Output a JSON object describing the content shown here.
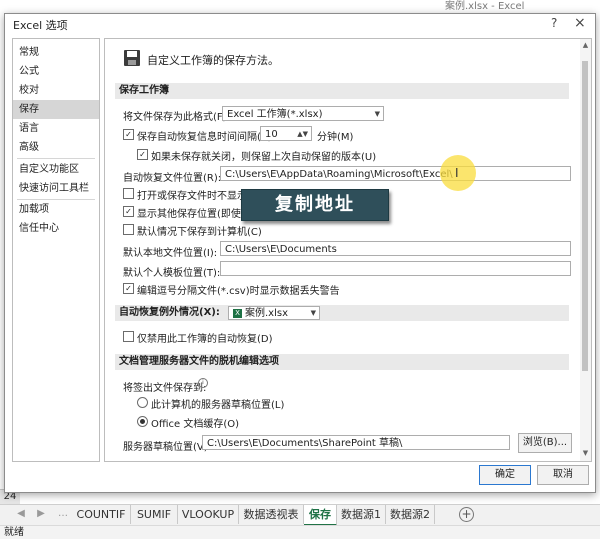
{
  "excel": {
    "window_title": "案例.xlsx - Excel",
    "row_number": "24",
    "status": "就绪",
    "sheets": [
      "COUNTIF",
      "SUMIF",
      "VLOOKUP",
      "数据透视表",
      "保存",
      "数据源1",
      "数据源2"
    ],
    "active_sheet": "保存"
  },
  "dialog": {
    "title": "Excel 选项",
    "help": "?",
    "close": "×",
    "nav": [
      "常规",
      "公式",
      "校对",
      "保存",
      "语言",
      "高级",
      "自定义功能区",
      "快速访问工具栏",
      "加载项",
      "信任中心"
    ],
    "selected_nav": "保存",
    "header_text": "自定义工作簿的保存方法。",
    "sections": {
      "save_workbook": "保存工作簿",
      "autorecover_exceptions": "自动恢复例外情况(X):",
      "offline_editing": "文档管理服务器文件的脱机编辑选项"
    },
    "format_label": "将文件保存为此格式(F):",
    "format_value": "Excel 工作簿(*.xlsx)",
    "autorecover_label": "保存自动恢复信息时间间隔(A)",
    "autorecover_minutes": "10",
    "minutes_label": "分钟(M)",
    "keep_last_label": "如果未保存就关闭，则保留上次自动保留的版本(U)",
    "autorecover_loc_label": "自动恢复文件位置(R):",
    "autorecover_loc_value": "C:\\Users\\E\\AppData\\Roaming\\Microsoft\\Excel\\",
    "backstage_label": "打开或保存文件时不显示 Backstage(S)",
    "show_more_label": "显示其他保存位置(即使可能需要登录)(S)",
    "default_local_label": "默认情况下保存到计算机(C)",
    "default_local_loc_label": "默认本地文件位置(I):",
    "default_local_loc_value": "C:\\Users\\E\\Documents",
    "personal_template_label": "默认个人模板位置(T):",
    "personal_template_value": "",
    "csv_warning_label": "编辑逗号分隔文件(*.csv)时显示数据丢失警告",
    "exception_workbook": "案例.xlsx",
    "disable_autorecover_label": "仅禁用此工作簿的自动恢复(D)",
    "checkout_label": "将签出文件保存到:",
    "server_drafts_label": "此计算机的服务器草稿位置(L)",
    "office_cache_label": "Office 文档缓存(O)",
    "drafts_loc_label": "服务器草稿位置(V):",
    "drafts_loc_value": "C:\\Users\\E\\Documents\\SharePoint 草稿\\",
    "browse_label": "浏览(B)...",
    "ok_label": "确定",
    "cancel_label": "取消",
    "checkmark": "✓",
    "overlay_text": "复制地址",
    "ibeam": "I"
  }
}
